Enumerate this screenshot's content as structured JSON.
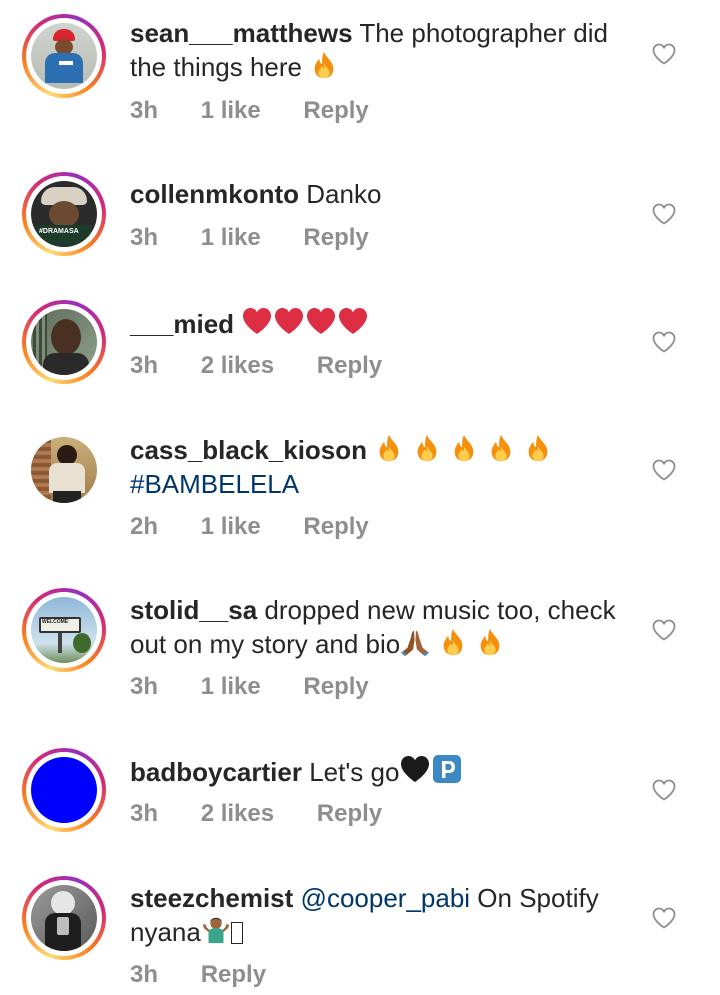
{
  "comments": [
    {
      "username": "sean___matthews",
      "text": "The photographer did the things here",
      "time": "3h",
      "likes": "1 like",
      "reply": "Reply"
    },
    {
      "username": "collenmkonto",
      "text": "Danko",
      "time": "3h",
      "likes": "1 like",
      "reply": "Reply",
      "avatar_tag": "#DRAMASA"
    },
    {
      "username": "___mied",
      "text": "",
      "time": "3h",
      "likes": "2 likes",
      "reply": "Reply"
    },
    {
      "username": "cass_black_kioson",
      "text": "",
      "hashtag": "#BAMBELELA",
      "time": "2h",
      "likes": "1 like",
      "reply": "Reply"
    },
    {
      "username": "stolid__sa",
      "text": "dropped new music too, check out on my story and bio",
      "time": "3h",
      "likes": "1 like",
      "reply": "Reply",
      "avatar_sign": "WELCOME"
    },
    {
      "username": "badboycartier",
      "text": "Let's go",
      "time": "3h",
      "likes": "2 likes",
      "reply": "Reply"
    },
    {
      "username": "steezchemist",
      "mention": "@cooper_pabi",
      "text": "On Spotify nyana",
      "time": "3h",
      "reply": "Reply"
    }
  ],
  "icons": {
    "like": "heart-outline-icon",
    "fire": "fire-emoji",
    "red_heart": "red-heart-emoji",
    "black_heart": "black-heart-emoji",
    "praying_hands": "folded-hands-emoji",
    "parking": "p-button-emoji",
    "shrug": "shrug-emoji"
  },
  "colors": {
    "text": "#262626",
    "meta": "#8e8e8e",
    "link": "#00376b",
    "avatar_blue": "#0000ff"
  }
}
